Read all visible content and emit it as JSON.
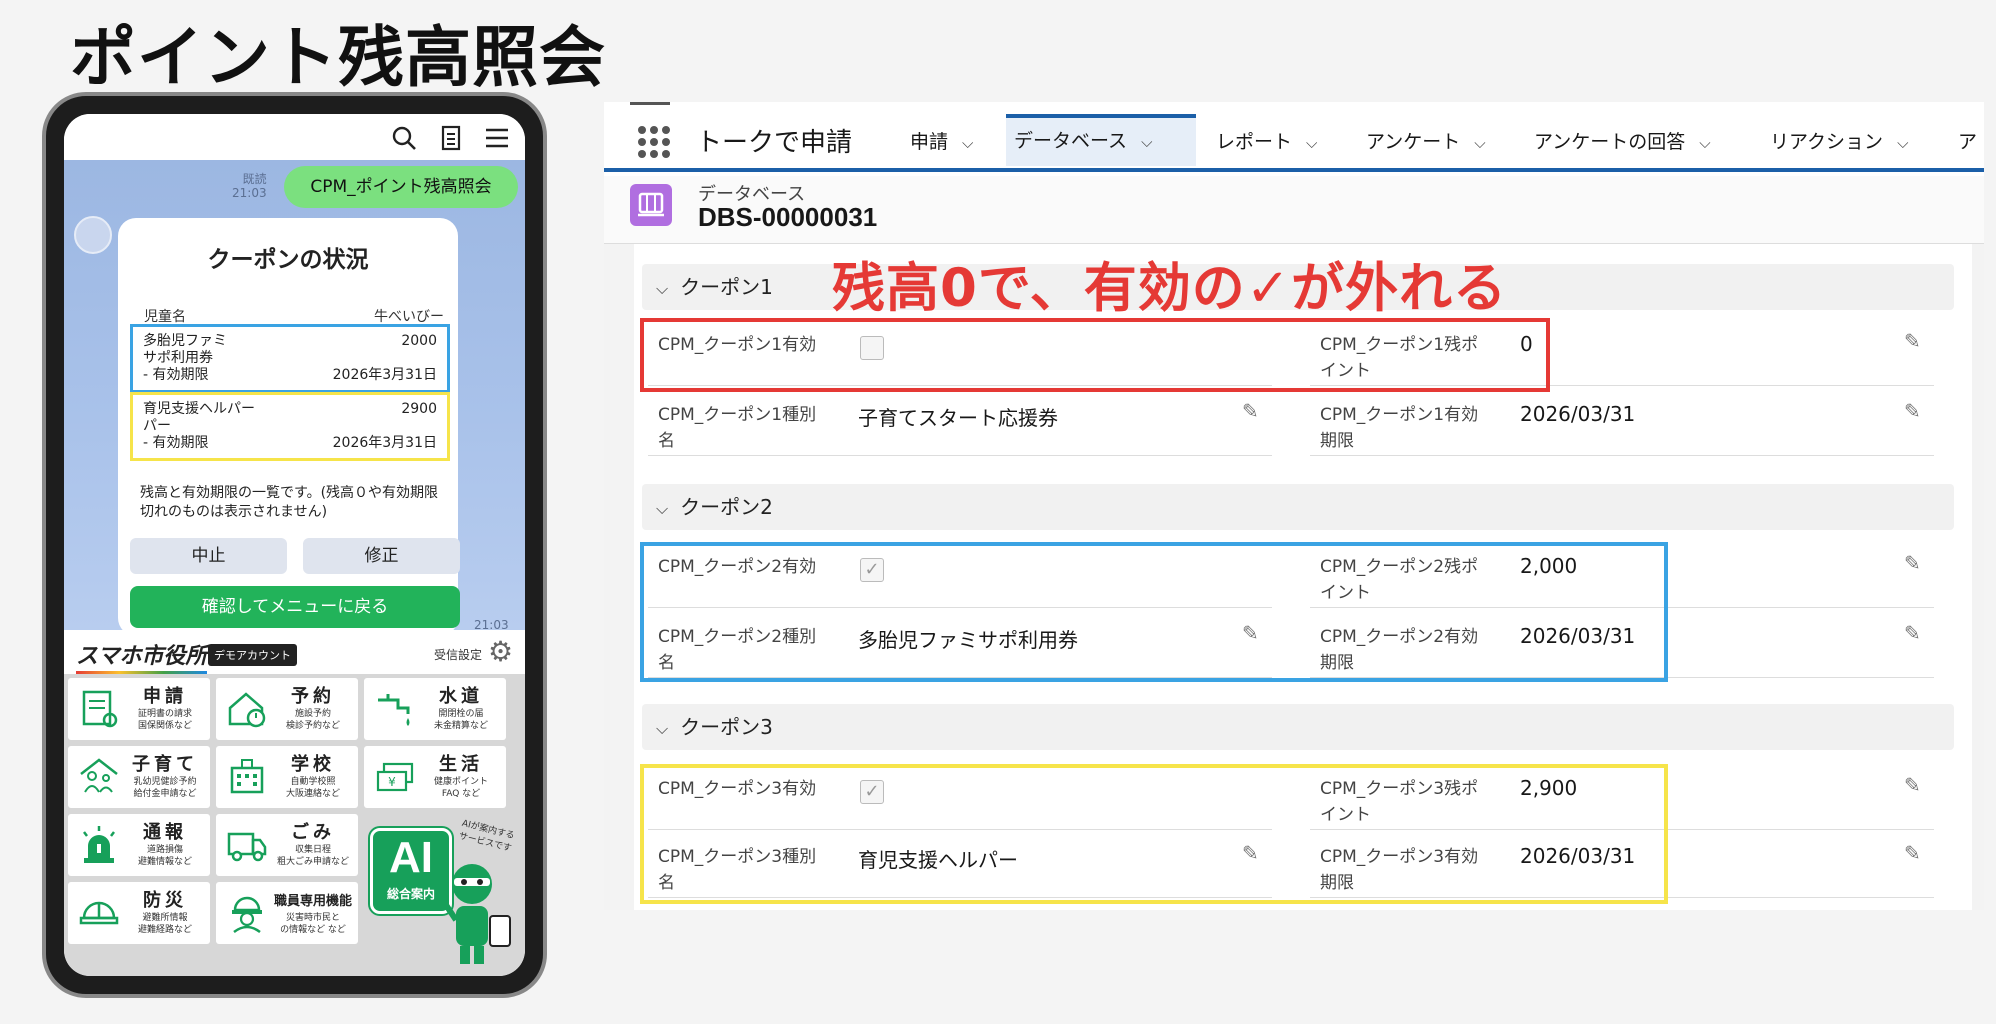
{
  "page_title": "ポイント残高照会",
  "colors": {
    "blue": "#3aa3e3",
    "yellow": "#f6e44a",
    "red": "#e53935",
    "green": "#22b35a",
    "brand_blue": "#1b5fa8"
  },
  "phone": {
    "header_icons": [
      "search-icon",
      "document-icon",
      "hamburger-menu-icon"
    ],
    "chat": {
      "read_label": "既読",
      "time_top": "21:03",
      "user_message": "CPM_ポイント残高照会",
      "card": {
        "title": "クーポンの状況",
        "child_label": "児童名",
        "child_name": "牛べいびー",
        "coupons": [
          {
            "name_line1": "多胎児ファミ",
            "name_line2": "サポ利用券",
            "value": "2000",
            "expiry_label": "- 有効期限",
            "expiry": "2026年3月31日"
          },
          {
            "name_line1": "育児支援ヘルパー",
            "name_line2": "パー",
            "value": "2900",
            "expiry_label": "- 有効期限",
            "expiry": "2026年3月31日"
          }
        ],
        "note": "残高と有効期限の一覧です。(残高０や有効期限切れのものは表示されません)",
        "cancel_button": "中止",
        "edit_button": "修正",
        "confirm_button": "確認してメニューに戻る"
      },
      "time_bottom": "21:03"
    },
    "muni": {
      "name": "スマホ市役所",
      "badge": "デモアカウント",
      "setting": "受信設定"
    },
    "menu": [
      {
        "title": "申請",
        "sub": "証明書の請求\n国保関係など",
        "icon": "document-icon"
      },
      {
        "title": "予約",
        "sub": "施設予約\n検診予約など",
        "icon": "house-clock-icon"
      },
      {
        "title": "水道",
        "sub": "開閉栓の届\n未金精算など",
        "icon": "faucet-icon"
      },
      {
        "title": "子育て",
        "sub": "乳幼児健診予約\n給付金申請など",
        "icon": "family-icon"
      },
      {
        "title": "学校",
        "sub": "自動学校照\n大阪連絡など",
        "icon": "school-icon"
      },
      {
        "title": "生活",
        "sub": "健康ポイント\nFAQ など",
        "icon": "money-icon"
      },
      {
        "title": "通報",
        "sub": "道路損傷\n避難情報など",
        "icon": "alert-light-icon"
      },
      {
        "title": "ごみ",
        "sub": "収集日程\n粗大ごみ申請など",
        "icon": "truck-icon"
      },
      {
        "title": "防災",
        "sub": "避難所情報\n避難経路など",
        "icon": "helmet-icon"
      },
      {
        "title": "職員専用機能",
        "sub": "災害時市民と\nの情報など など",
        "icon": "worker-icon"
      }
    ],
    "ai": {
      "big": "AI",
      "small": "総合案内",
      "side": "AIが案内する\nサービスです"
    }
  },
  "sf": {
    "app_name": "トークで申請",
    "nav": [
      {
        "label": "申請",
        "active": false
      },
      {
        "label": "データベース",
        "active": true
      },
      {
        "label": "レポート",
        "active": false
      },
      {
        "label": "アンケート",
        "active": false
      },
      {
        "label": "アンケートの回答",
        "active": false
      },
      {
        "label": "リアクション",
        "active": false
      },
      {
        "label": "ア",
        "active": false
      }
    ],
    "record_type": "データベース",
    "record_name": "DBS-00000031",
    "annotation": "残高0で、有効の✓が外れる",
    "sections": [
      {
        "title": "クーポン1",
        "fields": [
          {
            "label": "CPM_クーポン1有効",
            "type": "checkbox",
            "checked": false
          },
          {
            "label": "CPM_クーポン1残ポイント",
            "value": "0"
          },
          {
            "label": "CPM_クーポン1種別名",
            "value": "子育てスタート応援券"
          },
          {
            "label": "CPM_クーポン1有効期限",
            "value": "2026/03/31"
          }
        ]
      },
      {
        "title": "クーポン2",
        "fields": [
          {
            "label": "CPM_クーポン2有効",
            "type": "checkbox",
            "checked": true
          },
          {
            "label": "CPM_クーポン2残ポイント",
            "value": "2,000"
          },
          {
            "label": "CPM_クーポン2種別名",
            "value": "多胎児ファミサポ利用券"
          },
          {
            "label": "CPM_クーポン2有効期限",
            "value": "2026/03/31"
          }
        ]
      },
      {
        "title": "クーポン3",
        "fields": [
          {
            "label": "CPM_クーポン3有効",
            "type": "checkbox",
            "checked": true
          },
          {
            "label": "CPM_クーポン3残ポイント",
            "value": "2,900"
          },
          {
            "label": "CPM_クーポン3種別名",
            "value": "育児支援ヘルパー"
          },
          {
            "label": "CPM_クーポン3有効期限",
            "value": "2026/03/31"
          }
        ]
      }
    ]
  }
}
